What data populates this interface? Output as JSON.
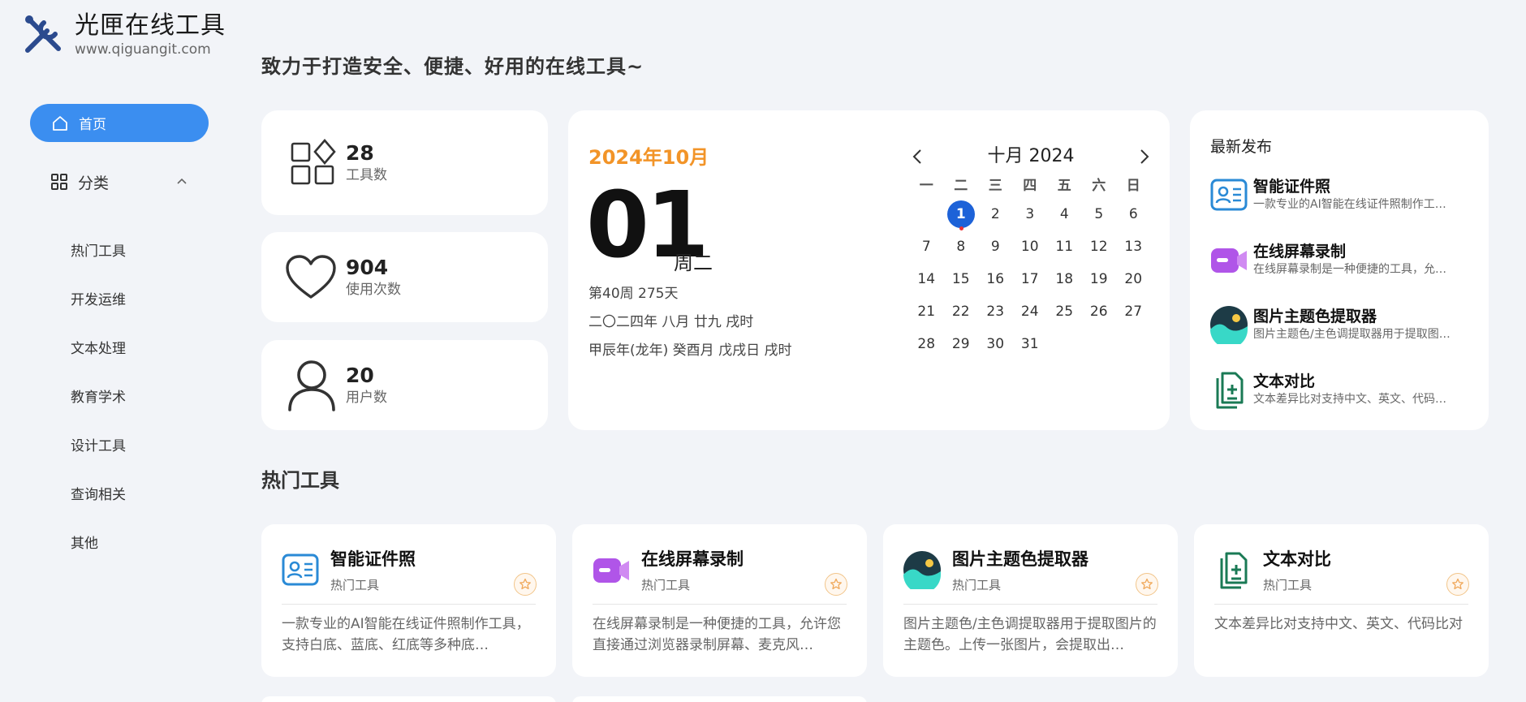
{
  "brand": {
    "title": "光匣在线工具",
    "domain": "www.qiguangit.com"
  },
  "nav": {
    "home": "首页",
    "category": "分类",
    "sub": [
      "热门工具",
      "开发运维",
      "文本处理",
      "教育学术",
      "设计工具",
      "查询相关",
      "其他"
    ]
  },
  "slogan": "致力于打造安全、便捷、好用的在线工具~",
  "stats": [
    {
      "value": "28",
      "label": "工具数",
      "icon": "apps-icon"
    },
    {
      "value": "904",
      "label": "使用次数",
      "icon": "heart-icon"
    },
    {
      "value": "20",
      "label": "用户数",
      "icon": "user-icon"
    }
  ],
  "calendar": {
    "month_label": "2024年10月",
    "day": "01",
    "weekday": "周二",
    "week_info": "第40周 275天",
    "lunar": "二〇二四年 八月 廿九 戌时",
    "ganzhi": "甲辰年(龙年) 癸酉月 戊戌日 戌时",
    "header": "十月 2024",
    "weekdays": [
      "一",
      "二",
      "三",
      "四",
      "五",
      "六",
      "日"
    ],
    "weeks": [
      [
        "",
        "1",
        "2",
        "3",
        "4",
        "5",
        "6"
      ],
      [
        "7",
        "8",
        "9",
        "10",
        "11",
        "12",
        "13"
      ],
      [
        "14",
        "15",
        "16",
        "17",
        "18",
        "19",
        "20"
      ],
      [
        "21",
        "22",
        "23",
        "24",
        "25",
        "26",
        "27"
      ],
      [
        "28",
        "29",
        "30",
        "31",
        "",
        "",
        ""
      ]
    ],
    "today": "1"
  },
  "latest": {
    "title": "最新发布",
    "items": [
      {
        "title": "智能证件照",
        "desc": "一款专业的AI智能在线证件照制作工…",
        "icon": "id-card-icon"
      },
      {
        "title": "在线屏幕录制",
        "desc": "在线屏幕录制是一种便捷的工具，允…",
        "icon": "video-camera-icon"
      },
      {
        "title": "图片主题色提取器",
        "desc": "图片主题色/主色调提取器用于提取图…",
        "icon": "landscape-image-icon"
      },
      {
        "title": "文本对比",
        "desc": "文本差异比对支持中文、英文、代码…",
        "icon": "document-compare-icon"
      }
    ]
  },
  "hot": {
    "title": "热门工具",
    "items": [
      {
        "title": "智能证件照",
        "category": "热门工具",
        "desc": "一款专业的AI智能在线证件照制作工具，支持白底、蓝底、红底等多种底…",
        "icon": "id-card-icon"
      },
      {
        "title": "在线屏幕录制",
        "category": "热门工具",
        "desc": "在线屏幕录制是一种便捷的工具，允许您直接通过浏览器录制屏幕、麦克风…",
        "icon": "video-camera-icon"
      },
      {
        "title": "图片主题色提取器",
        "category": "热门工具",
        "desc": "图片主题色/主色调提取器用于提取图片的主题色。上传一张图片，会提取出…",
        "icon": "landscape-image-icon"
      },
      {
        "title": "文本对比",
        "category": "热门工具",
        "desc": "文本差异比对支持中文、英文、代码比对",
        "icon": "document-compare-icon"
      }
    ]
  },
  "colors": {
    "accent": "#3b8ef0",
    "month": "#f29428",
    "today": "#1d62d8",
    "star": "#f0a85a"
  }
}
